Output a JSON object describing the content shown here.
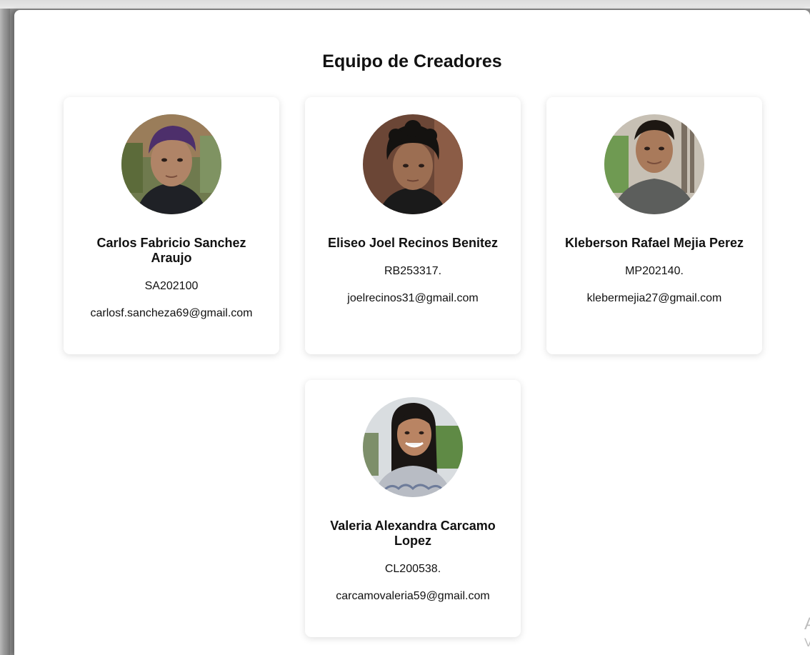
{
  "page": {
    "title": "Equipo de Creadores"
  },
  "members": [
    {
      "name": "Carlos Fabricio Sanchez Araujo",
      "code": "SA202100",
      "email": "carlosf.sancheza69@gmail.com",
      "avatar_icon": "person-photo"
    },
    {
      "name": "Eliseo Joel Recinos Benitez",
      "code": "RB253317.",
      "email": "joelrecinos31@gmail.com",
      "avatar_icon": "person-photo"
    },
    {
      "name": "Kleberson Rafael Mejia Perez",
      "code": "MP202140.",
      "email": "klebermejia27@gmail.com",
      "avatar_icon": "person-photo"
    },
    {
      "name": "Valeria Alexandra Carcamo Lopez",
      "code": "CL200538.",
      "email": "carcamovaleria59@gmail.com",
      "avatar_icon": "person-photo"
    }
  ],
  "watermark": {
    "line1": "Ac",
    "line2": "Ve"
  },
  "colors": {
    "card_bg": "#ffffff",
    "text": "#111111",
    "backdrop": "#8c8c8c"
  }
}
